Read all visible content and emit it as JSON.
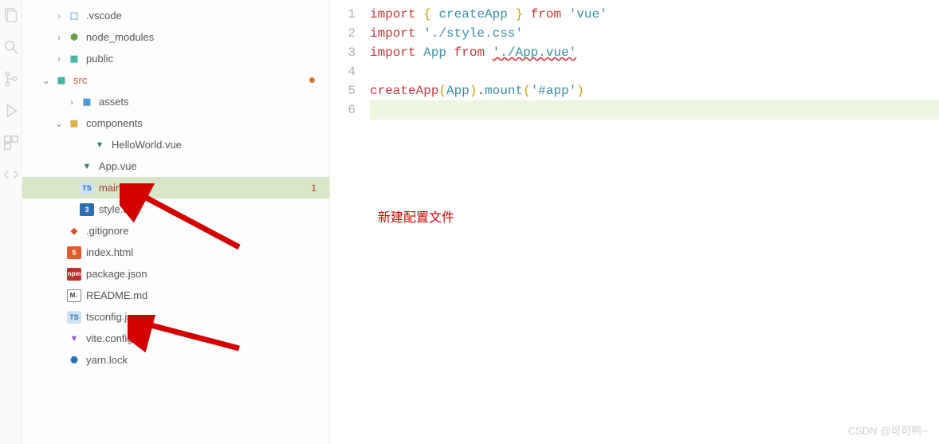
{
  "tree": [
    {
      "name": ".vscode",
      "indent": 38,
      "chevron": "right",
      "icon": "vscode",
      "iconGlyph": "⬚"
    },
    {
      "name": "node_modules",
      "indent": 38,
      "chevron": "right",
      "icon": "node",
      "iconGlyph": "⬢"
    },
    {
      "name": "public",
      "indent": 38,
      "chevron": "right",
      "icon": "public",
      "iconGlyph": "▦"
    },
    {
      "name": "src",
      "indent": 22,
      "chevron": "down",
      "icon": "src",
      "iconGlyph": "▦",
      "srcFolder": true,
      "modifiedDot": true
    },
    {
      "name": "assets",
      "indent": 54,
      "chevron": "right",
      "icon": "assets",
      "iconGlyph": "▦"
    },
    {
      "name": "components",
      "indent": 38,
      "chevron": "down",
      "icon": "components",
      "iconGlyph": "▦"
    },
    {
      "name": "HelloWorld.vue",
      "indent": 70,
      "chevron": "",
      "icon": "vue",
      "iconGlyph": "▼"
    },
    {
      "name": "App.vue",
      "indent": 54,
      "chevron": "",
      "icon": "vue",
      "iconGlyph": "▼"
    },
    {
      "name": "main.ts",
      "indent": 54,
      "chevron": "",
      "icon": "ts",
      "iconGlyph": "TS",
      "active": true,
      "errorCount": "1"
    },
    {
      "name": "style.css",
      "indent": 54,
      "chevron": "",
      "icon": "css",
      "iconGlyph": "3"
    },
    {
      "name": ".gitignore",
      "indent": 38,
      "chevron": "",
      "icon": "git",
      "iconGlyph": "◆"
    },
    {
      "name": "index.html",
      "indent": 38,
      "chevron": "",
      "icon": "html",
      "iconGlyph": "5"
    },
    {
      "name": "package.json",
      "indent": 38,
      "chevron": "",
      "icon": "npm",
      "iconGlyph": "npm"
    },
    {
      "name": "README.md",
      "indent": 38,
      "chevron": "",
      "icon": "md",
      "iconGlyph": "M↓"
    },
    {
      "name": "tsconfig.json",
      "indent": 38,
      "chevron": "",
      "icon": "ts",
      "iconGlyph": "TS"
    },
    {
      "name": "vite.config.ts",
      "indent": 38,
      "chevron": "",
      "icon": "vite",
      "iconGlyph": "▼"
    },
    {
      "name": "yarn.lock",
      "indent": 38,
      "chevron": "",
      "icon": "yarn",
      "iconGlyph": "⬣"
    }
  ],
  "gutter": [
    "1",
    "2",
    "3",
    "4",
    "5",
    "6"
  ],
  "code": {
    "l1": {
      "import": "import",
      "lb": "{",
      "createApp": "createApp",
      "rb": "}",
      "from": "from",
      "vue": "'vue'"
    },
    "l2": {
      "import": "import",
      "style": "'./style.css'"
    },
    "l3": {
      "import": "import",
      "App": "App",
      "from": "from",
      "appvue": "'./App.vue'"
    },
    "l5": {
      "createApp": "createApp",
      "lp": "(",
      "App": "App",
      "rp": ")",
      "dot": ".",
      "mount": "mount",
      "lp2": "(",
      "app": "'#app'",
      "rp2": ")"
    }
  },
  "annotation": "新建配置文件",
  "watermark": "CSDN @可可鸭~"
}
